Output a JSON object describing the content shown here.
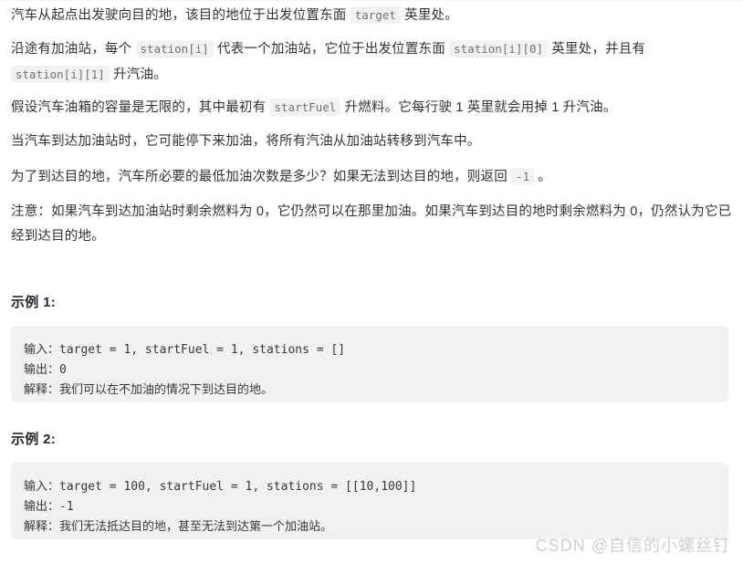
{
  "document": {
    "paragraphs": [
      {
        "id": "p1",
        "segments": [
          {
            "type": "text",
            "value": "汽车从起点出发驶向目的地，该目的地位于出发位置东面 "
          },
          {
            "type": "code",
            "value": "target"
          },
          {
            "type": "text",
            "value": " 英里处。"
          }
        ]
      },
      {
        "id": "p2",
        "segments": [
          {
            "type": "text",
            "value": "沿途有加油站，每个 "
          },
          {
            "type": "code",
            "value": "station[i]"
          },
          {
            "type": "text",
            "value": " 代表一个加油站，它位于出发位置东面 "
          },
          {
            "type": "code",
            "value": "station[i][0]"
          },
          {
            "type": "text",
            "value": " 英里处，并且有 "
          },
          {
            "type": "code",
            "value": "station[i][1]"
          },
          {
            "type": "text",
            "value": " 升汽油。"
          }
        ]
      },
      {
        "id": "p3",
        "segments": [
          {
            "type": "text",
            "value": "假设汽车油箱的容量是无限的，其中最初有 "
          },
          {
            "type": "code",
            "value": "startFuel"
          },
          {
            "type": "text",
            "value": " 升燃料。它每行驶 1 英里就会用掉 1 升汽油。"
          }
        ]
      },
      {
        "id": "p4",
        "segments": [
          {
            "type": "text",
            "value": "当汽车到达加油站时，它可能停下来加油，将所有汽油从加油站转移到汽车中。"
          }
        ]
      },
      {
        "id": "p5",
        "segments": [
          {
            "type": "text",
            "value": "为了到达目的地，汽车所必要的最低加油次数是多少？如果无法到达目的地，则返回 "
          },
          {
            "type": "code",
            "value": "-1"
          },
          {
            "type": "text",
            "value": " 。"
          }
        ]
      },
      {
        "id": "p6",
        "segments": [
          {
            "type": "text",
            "value": "注意：如果汽车到达加油站时剩余燃料为 0，它仍然可以在那里加油。如果汽车到达目的地时剩余燃料为 0，仍然认为它已经到达目的地。"
          }
        ]
      }
    ],
    "examples": [
      {
        "heading": "示例 1:",
        "lines": [
          "输入：target = 1, startFuel = 1, stations = []",
          "输出：0",
          "解释：我们可以在不加油的情况下到达目的地。"
        ]
      },
      {
        "heading": "示例 2:",
        "lines": [
          "输入：target = 100, startFuel = 1, stations = [[10,100]]",
          "输出：-1",
          "解释：我们无法抵达目的地，甚至无法到达第一个加油站。"
        ]
      }
    ],
    "watermark": "CSDN @自信的小螺丝钉",
    "colors": {
      "text": "#2f3337",
      "heading": "#21262c",
      "inline_code_bg": "#f2f2f2",
      "inline_code_text": "#6d7176",
      "codeblock_bg": "#f1f1f1",
      "codeblock_text": "#34383d",
      "watermark": "#cfcfcf",
      "page_bg": "#ffffff"
    }
  }
}
